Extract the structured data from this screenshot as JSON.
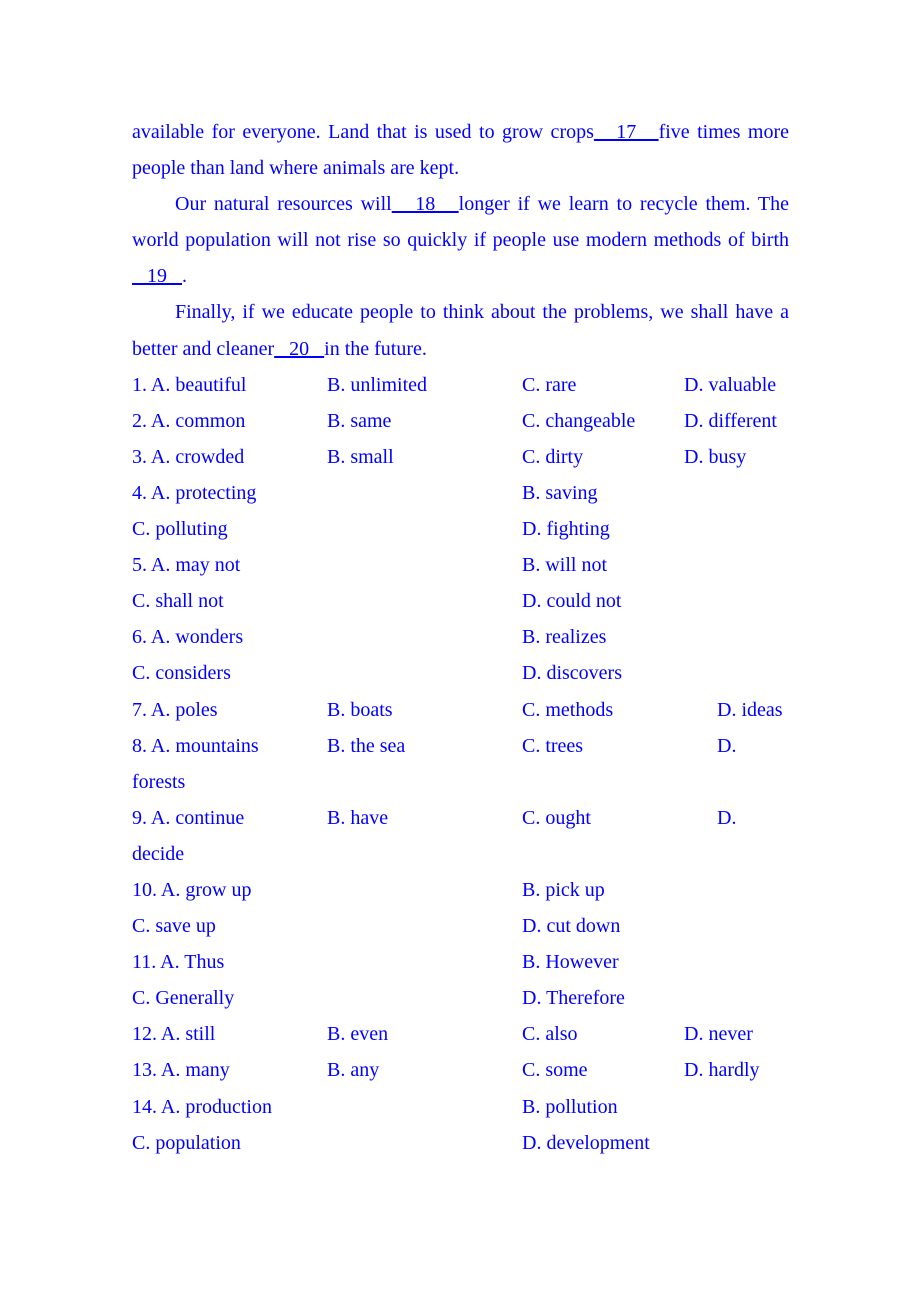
{
  "passage": {
    "p1": {
      "before": "available for everyone. Land that is used to grow crops",
      "blank": "___17___",
      "after": "five times more people than land where animals are kept."
    },
    "p2": {
      "before": "Our natural resources will",
      "blank": "___18___",
      "middle": "longer if we learn to recycle them. The world population will not rise so quickly if people use modern methods of birth",
      "blank2": "___19___",
      "after": "."
    },
    "p3": {
      "before": "Finally, if we educate people to think about the problems, we shall have a better and cleaner",
      "blank": "___20___",
      "after": "in the future."
    }
  },
  "questions": [
    {
      "num": "1.",
      "a": "A. beautiful",
      "b": "B. unlimited",
      "c": "C. rare",
      "d": "D. valuable"
    },
    {
      "num": "2.",
      "a": "A. common",
      "b": "B. same",
      "c": "C. changeable",
      "d": "D. different"
    },
    {
      "num": "3.",
      "a": "A. crowded",
      "b": "B. small",
      "c": "C. dirty",
      "d": "D. busy"
    },
    {
      "num": "4.",
      "a": "A. protecting",
      "b": "B. saving",
      "c": "C. polluting",
      "d": "D. fighting"
    },
    {
      "num": "5.",
      "a": "A. may not",
      "b": "B. will not",
      "c": "C. shall not",
      "d": "D. could not"
    },
    {
      "num": "6.",
      "a": "A. wonders",
      "b": "B. realizes",
      "c": "C. considers",
      "d": "D. discovers"
    },
    {
      "num": "7.",
      "a": "A. poles",
      "b": "B. boats",
      "c": "C. methods",
      "d": "D. ideas"
    },
    {
      "num": "8.",
      "a": "A. mountains",
      "b": "B. the sea",
      "c": "C. trees",
      "d": "D.",
      "d_wrap": "forests"
    },
    {
      "num": "9.",
      "a": "A. continue",
      "b": "B. have",
      "c": "C. ought",
      "d": "D.",
      "d_wrap": "decide"
    },
    {
      "num": "10.",
      "a": "A. grow up",
      "b": "B. pick up",
      "c": "C. save up",
      "d": "D. cut down"
    },
    {
      "num": "11.",
      "a": "A. Thus",
      "b": "B. However",
      "c": "C. Generally",
      "d": "D. Therefore"
    },
    {
      "num": "12.",
      "a": "A. still",
      "b": "B. even",
      "c": "C. also",
      "d": "D. never"
    },
    {
      "num": "13.",
      "a": "A. many",
      "b": "B. any",
      "c": "C. some",
      "d": "D. hardly"
    },
    {
      "num": "14.",
      "a": "A. production",
      "b": "B. pollution",
      "c": "C. population",
      "d": "D. development"
    }
  ]
}
